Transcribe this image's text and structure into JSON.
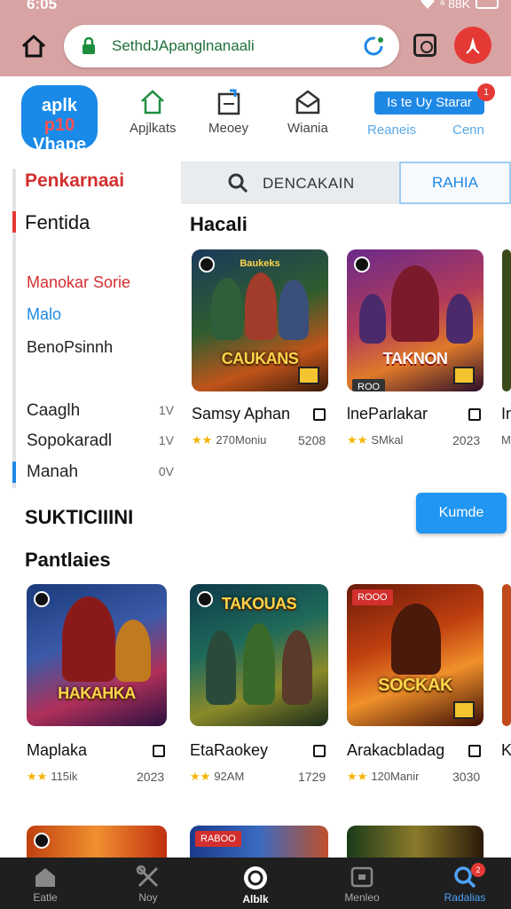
{
  "status": {
    "time": "6:05",
    "signal": "ᵃ 88K"
  },
  "browser": {
    "url": "SethdJApanglnanaali"
  },
  "header": {
    "logo_lines": [
      "aplk",
      "p10",
      "Vhape"
    ],
    "nav": [
      "Apjlkats",
      "Meoey",
      "Wiania"
    ],
    "store_button": "Is te Uy Starar",
    "store_badge": "1",
    "links": [
      "Reaneis",
      "Cenn"
    ]
  },
  "sidebar": {
    "title": "Penkarnaai",
    "subtitle": "Fentida",
    "links": [
      {
        "label": "Manokar Sorie",
        "color": "#d32f2f"
      },
      {
        "label": "Malo",
        "color": "#1e88e5"
      },
      {
        "label": "BenoPsinnh",
        "color": "#222222"
      }
    ],
    "rows": [
      {
        "label": "Caaglh",
        "count": "1V"
      },
      {
        "label": "Sopokaradl",
        "count": "1V"
      },
      {
        "label": "Manah",
        "count": "0V"
      }
    ]
  },
  "search": {
    "placeholder": "DENCAKAIN",
    "rank_button": "RAHIA"
  },
  "section_top": {
    "title": "Hacali",
    "games": [
      {
        "name": "Samsy Aphan",
        "rating": "270Moniu",
        "year": "5208",
        "art_text": "CAUKANS",
        "header_text": "Baukeks"
      },
      {
        "name": "lneParlakar",
        "rating": "SMkal",
        "year": "2023",
        "art_text": "TAKNON",
        "tag": "ROO"
      },
      {
        "name": "In",
        "rating": "M"
      }
    ]
  },
  "cta": {
    "label": "Kumde"
  },
  "section_mid": {
    "title": "SUKTICIIINI"
  },
  "section_bottom": {
    "title": "Pantlaies",
    "games": [
      {
        "name": "Maplaka",
        "rating": "115ik",
        "year": "2023",
        "art_text": "HAKAHKA"
      },
      {
        "name": "EtaRaokey",
        "rating": "92AM",
        "year": "1729",
        "art_text": "TAKOUAS"
      },
      {
        "name": "Arakacbladag",
        "rating": "120Manir",
        "year": "3030",
        "art_text": "SOCKAK",
        "tag": "ROOO"
      },
      {
        "name": "K"
      }
    ],
    "row3_tag": "RABOO"
  },
  "bottom_nav": [
    {
      "label": "Eatle"
    },
    {
      "label": "Noy"
    },
    {
      "label": "Alblk"
    },
    {
      "label": "Menleo"
    },
    {
      "label": "Radalias",
      "badge": "2"
    }
  ],
  "colors": {
    "accent": "#1e88e5",
    "red": "#d32f2f",
    "topbar": "#d8a3a3",
    "nav_bg": "#1f1f1f"
  }
}
